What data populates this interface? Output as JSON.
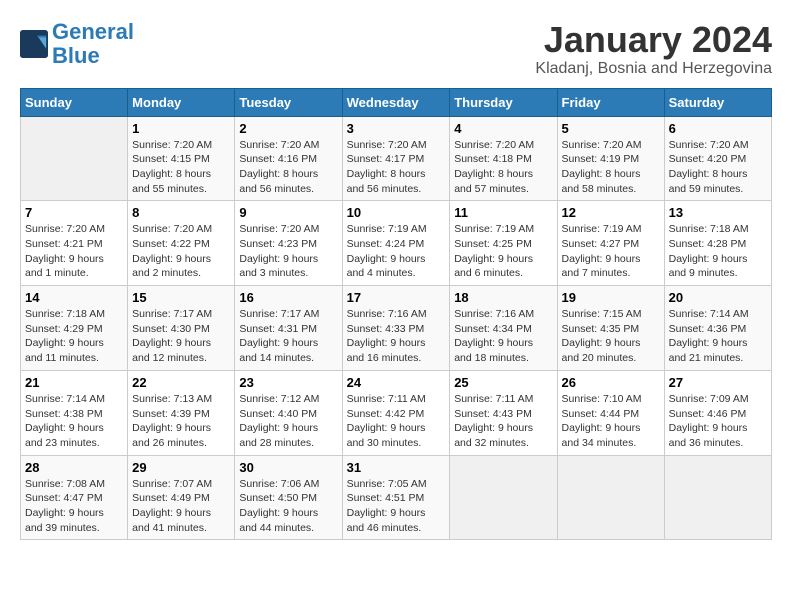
{
  "header": {
    "logo_line1": "General",
    "logo_line2": "Blue",
    "month": "January 2024",
    "location": "Kladanj, Bosnia and Herzegovina"
  },
  "weekdays": [
    "Sunday",
    "Monday",
    "Tuesday",
    "Wednesday",
    "Thursday",
    "Friday",
    "Saturday"
  ],
  "weeks": [
    [
      {
        "day": "",
        "text": ""
      },
      {
        "day": "1",
        "text": "Sunrise: 7:20 AM\nSunset: 4:15 PM\nDaylight: 8 hours\nand 55 minutes."
      },
      {
        "day": "2",
        "text": "Sunrise: 7:20 AM\nSunset: 4:16 PM\nDaylight: 8 hours\nand 56 minutes."
      },
      {
        "day": "3",
        "text": "Sunrise: 7:20 AM\nSunset: 4:17 PM\nDaylight: 8 hours\nand 56 minutes."
      },
      {
        "day": "4",
        "text": "Sunrise: 7:20 AM\nSunset: 4:18 PM\nDaylight: 8 hours\nand 57 minutes."
      },
      {
        "day": "5",
        "text": "Sunrise: 7:20 AM\nSunset: 4:19 PM\nDaylight: 8 hours\nand 58 minutes."
      },
      {
        "day": "6",
        "text": "Sunrise: 7:20 AM\nSunset: 4:20 PM\nDaylight: 8 hours\nand 59 minutes."
      }
    ],
    [
      {
        "day": "7",
        "text": "Sunrise: 7:20 AM\nSunset: 4:21 PM\nDaylight: 9 hours\nand 1 minute."
      },
      {
        "day": "8",
        "text": "Sunrise: 7:20 AM\nSunset: 4:22 PM\nDaylight: 9 hours\nand 2 minutes."
      },
      {
        "day": "9",
        "text": "Sunrise: 7:20 AM\nSunset: 4:23 PM\nDaylight: 9 hours\nand 3 minutes."
      },
      {
        "day": "10",
        "text": "Sunrise: 7:19 AM\nSunset: 4:24 PM\nDaylight: 9 hours\nand 4 minutes."
      },
      {
        "day": "11",
        "text": "Sunrise: 7:19 AM\nSunset: 4:25 PM\nDaylight: 9 hours\nand 6 minutes."
      },
      {
        "day": "12",
        "text": "Sunrise: 7:19 AM\nSunset: 4:27 PM\nDaylight: 9 hours\nand 7 minutes."
      },
      {
        "day": "13",
        "text": "Sunrise: 7:18 AM\nSunset: 4:28 PM\nDaylight: 9 hours\nand 9 minutes."
      }
    ],
    [
      {
        "day": "14",
        "text": "Sunrise: 7:18 AM\nSunset: 4:29 PM\nDaylight: 9 hours\nand 11 minutes."
      },
      {
        "day": "15",
        "text": "Sunrise: 7:17 AM\nSunset: 4:30 PM\nDaylight: 9 hours\nand 12 minutes."
      },
      {
        "day": "16",
        "text": "Sunrise: 7:17 AM\nSunset: 4:31 PM\nDaylight: 9 hours\nand 14 minutes."
      },
      {
        "day": "17",
        "text": "Sunrise: 7:16 AM\nSunset: 4:33 PM\nDaylight: 9 hours\nand 16 minutes."
      },
      {
        "day": "18",
        "text": "Sunrise: 7:16 AM\nSunset: 4:34 PM\nDaylight: 9 hours\nand 18 minutes."
      },
      {
        "day": "19",
        "text": "Sunrise: 7:15 AM\nSunset: 4:35 PM\nDaylight: 9 hours\nand 20 minutes."
      },
      {
        "day": "20",
        "text": "Sunrise: 7:14 AM\nSunset: 4:36 PM\nDaylight: 9 hours\nand 21 minutes."
      }
    ],
    [
      {
        "day": "21",
        "text": "Sunrise: 7:14 AM\nSunset: 4:38 PM\nDaylight: 9 hours\nand 23 minutes."
      },
      {
        "day": "22",
        "text": "Sunrise: 7:13 AM\nSunset: 4:39 PM\nDaylight: 9 hours\nand 26 minutes."
      },
      {
        "day": "23",
        "text": "Sunrise: 7:12 AM\nSunset: 4:40 PM\nDaylight: 9 hours\nand 28 minutes."
      },
      {
        "day": "24",
        "text": "Sunrise: 7:11 AM\nSunset: 4:42 PM\nDaylight: 9 hours\nand 30 minutes."
      },
      {
        "day": "25",
        "text": "Sunrise: 7:11 AM\nSunset: 4:43 PM\nDaylight: 9 hours\nand 32 minutes."
      },
      {
        "day": "26",
        "text": "Sunrise: 7:10 AM\nSunset: 4:44 PM\nDaylight: 9 hours\nand 34 minutes."
      },
      {
        "day": "27",
        "text": "Sunrise: 7:09 AM\nSunset: 4:46 PM\nDaylight: 9 hours\nand 36 minutes."
      }
    ],
    [
      {
        "day": "28",
        "text": "Sunrise: 7:08 AM\nSunset: 4:47 PM\nDaylight: 9 hours\nand 39 minutes."
      },
      {
        "day": "29",
        "text": "Sunrise: 7:07 AM\nSunset: 4:49 PM\nDaylight: 9 hours\nand 41 minutes."
      },
      {
        "day": "30",
        "text": "Sunrise: 7:06 AM\nSunset: 4:50 PM\nDaylight: 9 hours\nand 44 minutes."
      },
      {
        "day": "31",
        "text": "Sunrise: 7:05 AM\nSunset: 4:51 PM\nDaylight: 9 hours\nand 46 minutes."
      },
      {
        "day": "",
        "text": ""
      },
      {
        "day": "",
        "text": ""
      },
      {
        "day": "",
        "text": ""
      }
    ]
  ]
}
